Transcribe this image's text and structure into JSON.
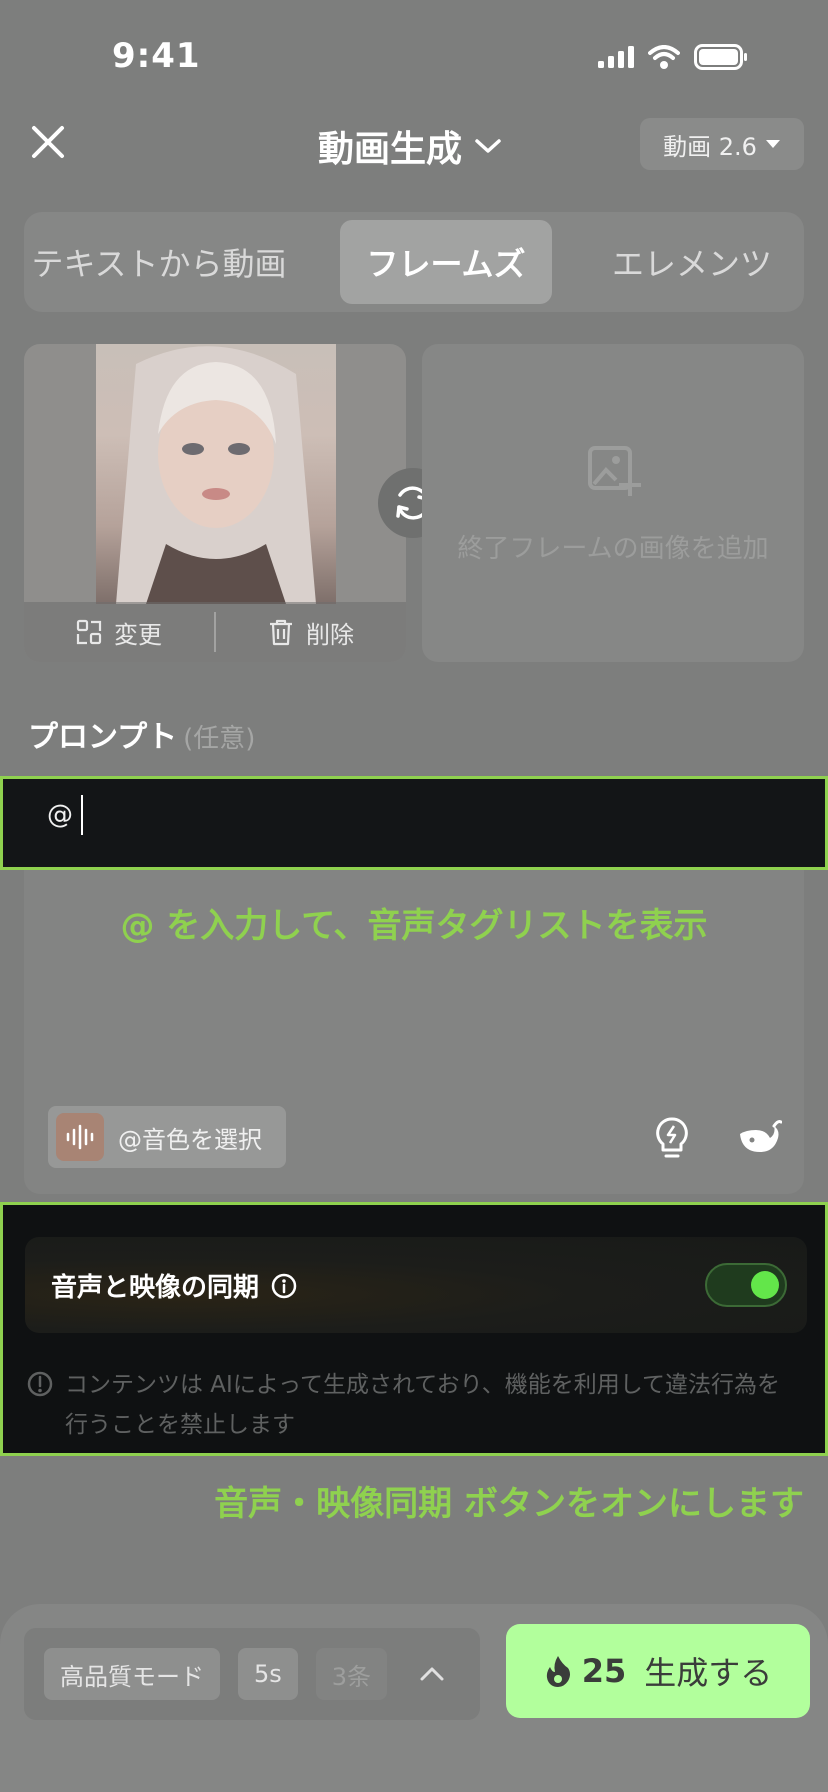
{
  "status_bar": {
    "time": "9:41"
  },
  "header": {
    "title": "動画生成",
    "model_label": "動画 2.6"
  },
  "tabs": [
    {
      "label": "テキストから動画"
    },
    {
      "label": "フレームズ"
    },
    {
      "label": "エレメンツ"
    }
  ],
  "frames": {
    "start": {
      "change_label": "変更",
      "delete_label": "削除"
    },
    "end": {
      "placeholder": "終了フレームの画像を追加"
    }
  },
  "prompt": {
    "label": "プロンプト",
    "optional": "(任意)",
    "input_value": "@",
    "hint": "@ を入力して、音声タグリストを表示",
    "voice_button_label": "@音色を選択"
  },
  "sync": {
    "label": "音声と映像の同期",
    "toggle_state": "on",
    "disclaimer": "コンテンツは AIによって生成されており、機能を利用して違法行為を行うことを禁止します",
    "hint": "音声・映像同期 ボタンをオンにします"
  },
  "bottom": {
    "quality": "高品質モード",
    "duration": "5s",
    "count": "3条",
    "cost": "25",
    "generate_label": "生成する"
  },
  "colors": {
    "highlight_green": "#8fd14f",
    "generate_bg": "#b2ff9c",
    "toggle_knob": "#63e64a"
  }
}
